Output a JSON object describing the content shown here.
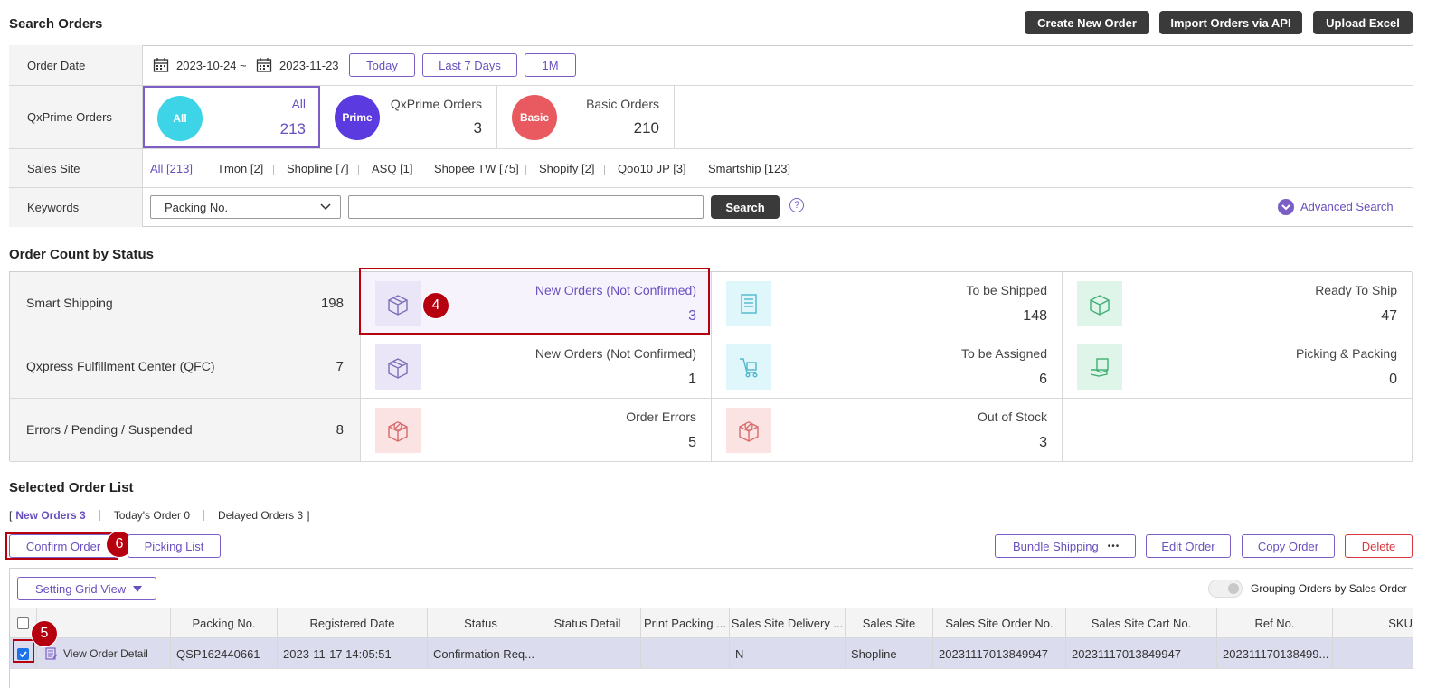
{
  "header": {
    "title": "Search Orders",
    "create_label": "Create New Order",
    "import_label": "Import Orders via API",
    "upload_label": "Upload Excel"
  },
  "search": {
    "order_date_label": "Order Date",
    "date_from": "2023-10-24",
    "tilde": "~",
    "date_to": "2023-11-23",
    "today_label": "Today",
    "last7_label": "Last 7 Days",
    "onem_label": "1M",
    "qxprime_label": "QxPrime Orders",
    "prime_tabs": [
      {
        "circle": "All",
        "title": "All",
        "count": "213",
        "color": "#3dd4e8"
      },
      {
        "circle": "Prime",
        "title": "QxPrime Orders",
        "count": "3",
        "color": "#5b3be0"
      },
      {
        "circle": "Basic",
        "title": "Basic Orders",
        "count": "210",
        "color": "#e85a5f"
      }
    ],
    "sales_site_label": "Sales Site",
    "sites": [
      "All [213]",
      "Tmon [2]",
      "Shopline [7]",
      "ASQ [1]",
      "Shopee TW [75]",
      "Shopify [2]",
      "Qoo10 JP [3]",
      "Smartship [123]"
    ],
    "keywords_label": "Keywords",
    "keyword_select": "Packing No.",
    "keyword_value": "",
    "search_label": "Search",
    "help_glyph": "?",
    "advanced_label": "Advanced Search"
  },
  "status": {
    "title": "Order Count by Status",
    "groups": [
      {
        "label": "Smart Shipping",
        "count": "198"
      },
      {
        "label": "Qxpress Fulfillment Center (QFC)",
        "count": "7"
      },
      {
        "label": "Errors / Pending / Suspended",
        "count": "8"
      }
    ],
    "cells": [
      {
        "label": "New Orders (Not Confirmed)",
        "count": "3",
        "icon": "box-icon"
      },
      {
        "label": "To be Shipped",
        "count": "148",
        "icon": "document-icon"
      },
      {
        "label": "Ready To Ship",
        "count": "47",
        "icon": "package-icon"
      },
      {
        "label": "New Orders (Not Confirmed)",
        "count": "1",
        "icon": "box-icon"
      },
      {
        "label": "To be Assigned",
        "count": "6",
        "icon": "cart-icon"
      },
      {
        "label": "Picking & Packing",
        "count": "0",
        "icon": "packing-icon"
      },
      {
        "label": "Order Errors",
        "count": "5",
        "icon": "error-box-icon"
      },
      {
        "label": "Out of Stock",
        "count": "3",
        "icon": "error-box-icon"
      }
    ],
    "colors": {
      "purple_bg": "#ebe6f7",
      "cyan_bg": "#dff6fa",
      "green_bg": "#e0f5ea",
      "pink_bg": "#fbe3e3"
    }
  },
  "badges": {
    "b4": "4",
    "b5": "5",
    "b6": "6"
  },
  "list": {
    "title": "Selected Order List",
    "open_bracket": "[",
    "close_bracket": "]",
    "filters": [
      "New Orders 3",
      "Today's Order 0",
      "Delayed Orders 3"
    ],
    "confirm_label": "Confirm Order",
    "picking_label": "Picking List",
    "bundle_label": "Bundle Shipping",
    "more_glyph": "•••",
    "edit_label": "Edit Order",
    "copy_label": "Copy Order",
    "delete_label": "Delete",
    "grid_view_label": "Setting Grid View",
    "grouping_label": "Grouping Orders by Sales Order",
    "columns": [
      "",
      "",
      "Packing No.",
      "Registered Date",
      "Status",
      "Status Detail",
      "Print Packing ...",
      "Sales Site Delivery ...",
      "Sales Site",
      "Sales Site Order No.",
      "Sales Site Cart No.",
      "Ref No.",
      "SKU"
    ],
    "row": {
      "view_label": "View Order Detail",
      "packing_no": "QSP162440661",
      "registered": "2023-11-17 14:05:51",
      "status": "Confirmation Req...",
      "status_detail": "",
      "print_packing": "",
      "delivery": "N",
      "sales_site": "Shopline",
      "order_no": "20231117013849947",
      "cart_no": "20231117013849947",
      "ref_no": "202311170138499..."
    }
  }
}
